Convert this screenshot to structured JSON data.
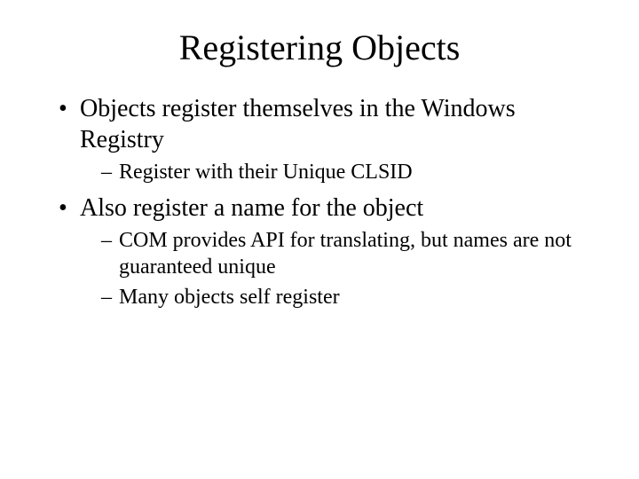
{
  "title": "Registering Objects",
  "bullets": [
    {
      "text": "Objects register themselves in the Windows Registry",
      "sub": [
        "Register with their Unique CLSID"
      ]
    },
    {
      "text": "Also register a name for the object",
      "sub": [
        "COM provides API for translating, but names are not guaranteed unique",
        "Many objects self register"
      ]
    }
  ]
}
